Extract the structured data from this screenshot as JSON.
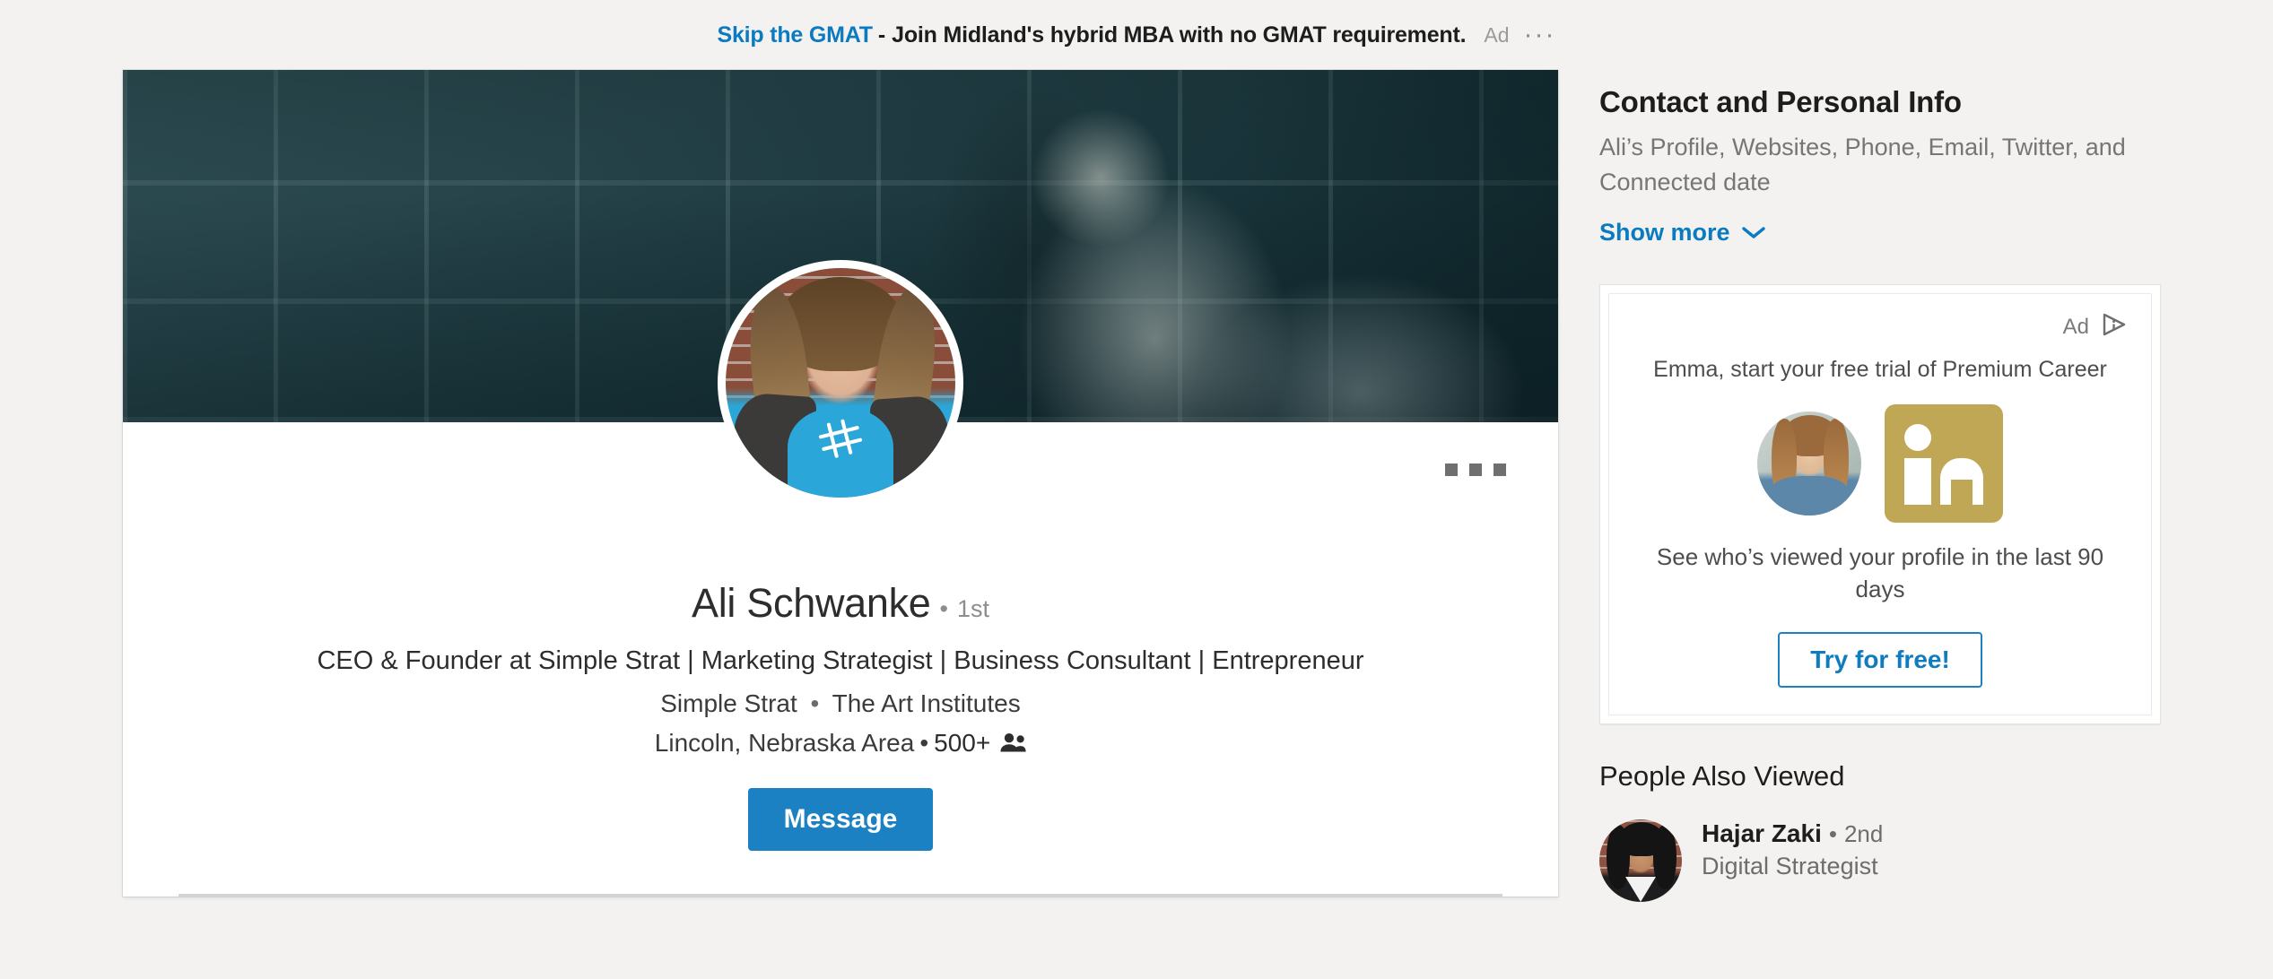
{
  "top_ad": {
    "link_text": "Skip the GMAT",
    "dash": "-",
    "body_text": "Join Midland's hybrid MBA with no GMAT requirement.",
    "ad_label": "Ad",
    "overflow_icon": "···"
  },
  "profile": {
    "overflow_menu": "more-options",
    "name": "Ali Schwanke",
    "degree_dot": "•",
    "degree": "1st",
    "headline": "CEO & Founder at Simple Strat | Marketing Strategist | Business Consultant | Entrepreneur",
    "company": "Simple Strat",
    "affiliation_sep": "•",
    "school": "The Art Institutes",
    "location": "Lincoln, Nebraska Area",
    "location_sep": "•",
    "connections": "500+",
    "message_label": "Message"
  },
  "contact": {
    "heading": "Contact and Personal Info",
    "summary": "Ali’s Profile, Websites, Phone, Email, Twitter, and Connected date",
    "show_more_label": "Show more"
  },
  "sidebar_ad": {
    "ad_label": "Ad",
    "headline": "Emma, start your free trial of Premium Career",
    "body": "See who’s viewed your profile in the last 90 days",
    "cta_label": "Try for free!"
  },
  "people_also_viewed": {
    "heading": "People Also Viewed",
    "items": [
      {
        "name": "Hajar Zaki",
        "degree_dot": "•",
        "degree": "2nd",
        "title": "Digital Strategist"
      }
    ]
  },
  "colors": {
    "page_background": "#f3f2f0",
    "link_blue": "#0b7bc1",
    "primary_button": "#1b81c2",
    "premium_gold": "#bfa756",
    "muted_text": "#767676",
    "cover_tint": "#173238"
  }
}
